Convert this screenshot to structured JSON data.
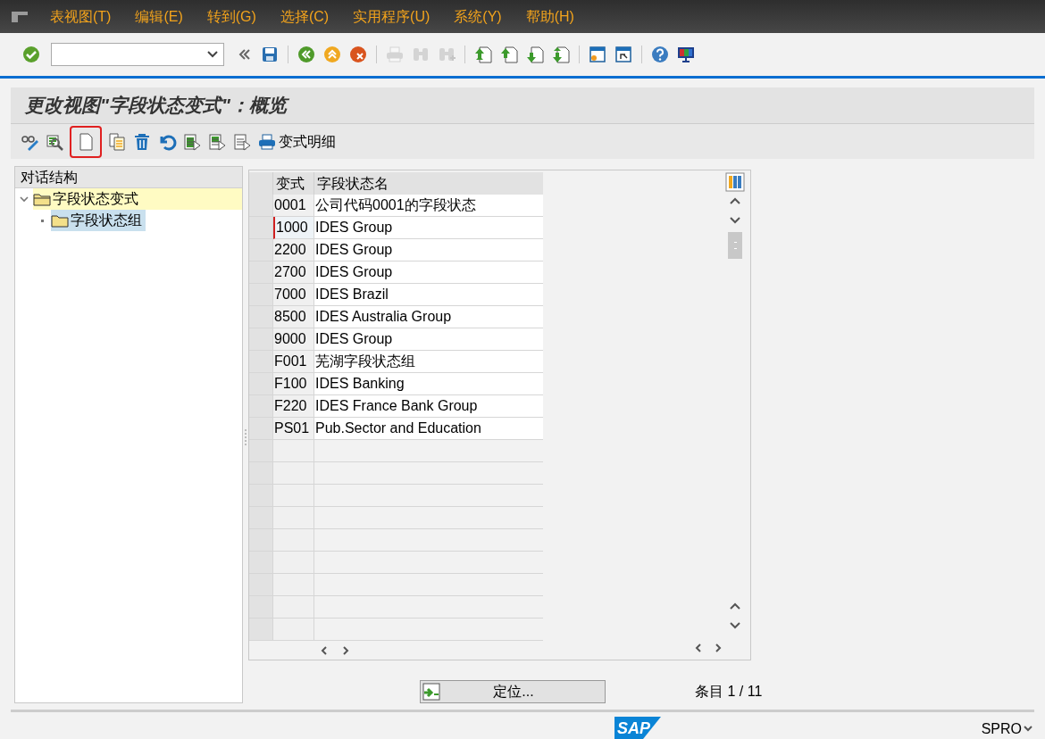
{
  "menu": [
    "表视图(T)",
    "编辑(E)",
    "转到(G)",
    "选择(C)",
    "实用程序(U)",
    "系统(Y)",
    "帮助(H)"
  ],
  "toolbar": [
    {
      "kind": "enter",
      "disabled": false
    },
    {
      "kind": "field"
    },
    {
      "kind": "collapse",
      "disabled": false
    },
    {
      "kind": "save",
      "disabled": false
    },
    {
      "kind": "separator"
    },
    {
      "kind": "back",
      "disabled": false
    },
    {
      "kind": "exit",
      "disabled": false
    },
    {
      "kind": "cancel",
      "disabled": false
    },
    {
      "kind": "separator"
    },
    {
      "kind": "print",
      "disabled": true
    },
    {
      "kind": "find",
      "disabled": true
    },
    {
      "kind": "find-next",
      "disabled": true
    },
    {
      "kind": "separator"
    },
    {
      "kind": "first-page",
      "disabled": false
    },
    {
      "kind": "prev-page",
      "disabled": false
    },
    {
      "kind": "next-page",
      "disabled": false
    },
    {
      "kind": "last-page",
      "disabled": false
    },
    {
      "kind": "separator"
    },
    {
      "kind": "new-session",
      "disabled": false
    },
    {
      "kind": "shortcut",
      "disabled": false
    },
    {
      "kind": "separator"
    },
    {
      "kind": "help",
      "disabled": false
    },
    {
      "kind": "layout",
      "disabled": false
    }
  ],
  "title": "更改视图\"字段状态变式\"：概览",
  "app_toolbar": {
    "items": [
      {
        "kind": "display-change",
        "highlighted": false
      },
      {
        "kind": "zoom",
        "highlighted": false
      },
      {
        "kind": "new",
        "highlighted": true
      },
      {
        "kind": "copy",
        "highlighted": false
      },
      {
        "kind": "delete",
        "highlighted": false
      },
      {
        "kind": "undo",
        "highlighted": false
      },
      {
        "kind": "select-all",
        "highlighted": false
      },
      {
        "kind": "select-block",
        "highlighted": false
      },
      {
        "kind": "deselect",
        "highlighted": false
      },
      {
        "kind": "print",
        "highlighted": false
      }
    ],
    "detail_button": "变式明细"
  },
  "tree": {
    "header": "对话结构",
    "items": [
      {
        "label": "字段状态变式",
        "current": true,
        "selected": false,
        "expanded": true,
        "children": [
          {
            "label": "字段状态组",
            "current": false,
            "selected": true
          }
        ]
      }
    ]
  },
  "table": {
    "columns": [
      "变式",
      "字段状态名"
    ],
    "rows": [
      {
        "cells": [
          "0001",
          "公司代码0001的字段状态"
        ],
        "focused": false
      },
      {
        "cells": [
          "1000",
          "IDES Group"
        ],
        "focused": true
      },
      {
        "cells": [
          "2200",
          "IDES Group"
        ],
        "focused": false
      },
      {
        "cells": [
          "2700",
          "IDES Group"
        ],
        "focused": false
      },
      {
        "cells": [
          "7000",
          "IDES Brazil"
        ],
        "focused": false
      },
      {
        "cells": [
          "8500",
          "IDES Australia Group"
        ],
        "focused": false
      },
      {
        "cells": [
          "9000",
          "IDES Group"
        ],
        "focused": false
      },
      {
        "cells": [
          "F001",
          "芜湖字段状态组"
        ],
        "focused": false
      },
      {
        "cells": [
          "F100",
          "IDES Banking"
        ],
        "focused": false
      },
      {
        "cells": [
          "F220",
          "IDES France Bank Group"
        ],
        "focused": false
      },
      {
        "cells": [
          "PS01",
          "Pub.Sector and Education"
        ],
        "focused": false
      }
    ]
  },
  "position_button": "定位...",
  "entry_count": "条目 1 / 11",
  "status_bar": {
    "logo": "SAP",
    "transaction": "SPRO"
  }
}
